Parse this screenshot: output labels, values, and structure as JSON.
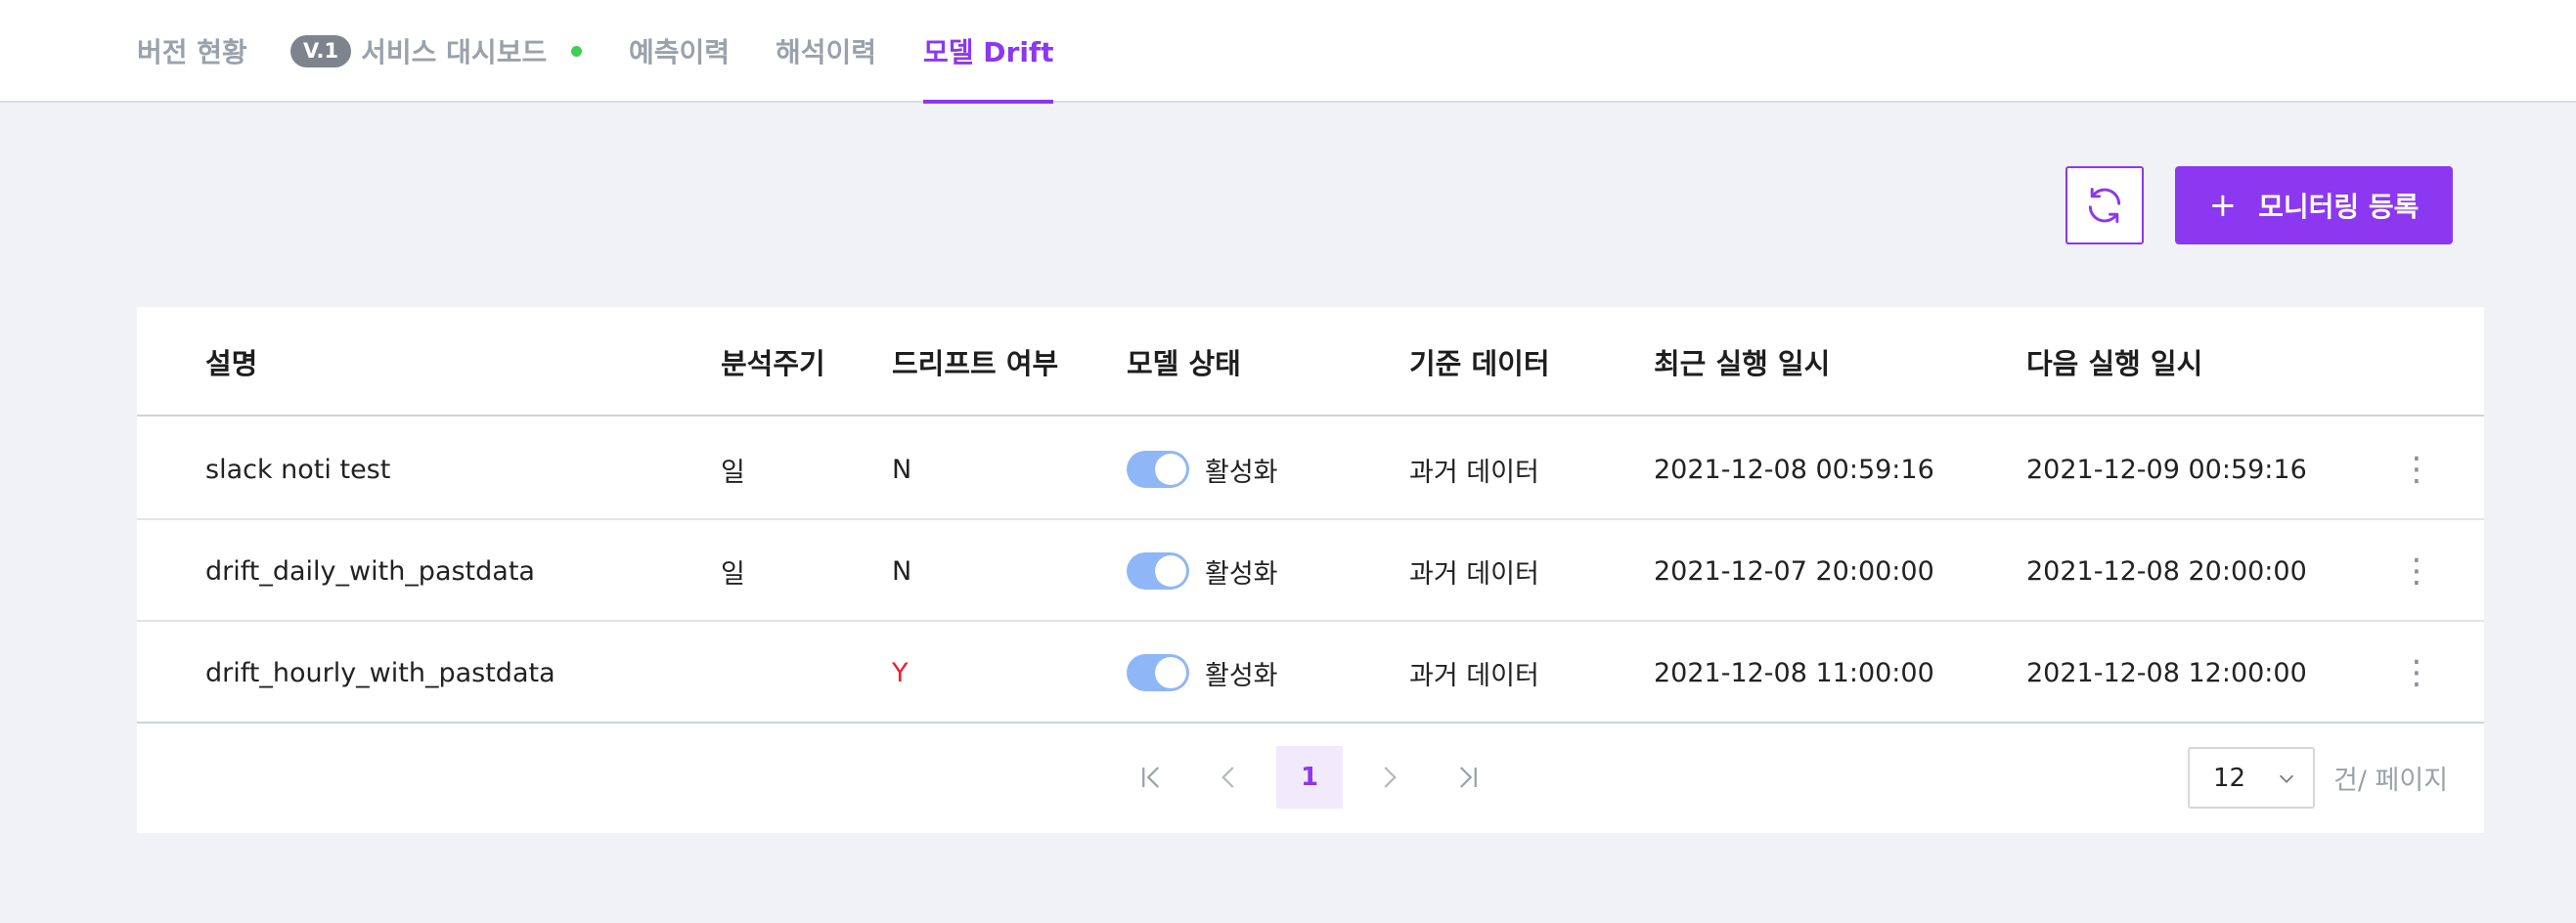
{
  "tabs": [
    {
      "label": "버전 현황",
      "active": false
    },
    {
      "badge": "V.1",
      "label": "서비스 대시보드",
      "active": false,
      "status_color": "#3ecf53"
    },
    {
      "label": "예측이력",
      "active": false
    },
    {
      "label": "해석이력",
      "active": false
    },
    {
      "label": "모델 Drift",
      "active": true
    }
  ],
  "toolbar": {
    "refresh_icon": "refresh-icon",
    "register_label": "모니터링 등록",
    "register_icon": "plus-icon"
  },
  "table": {
    "columns": [
      "설명",
      "분석주기",
      "드리프트 여부",
      "모델 상태",
      "기준 데이터",
      "최근 실행 일시",
      "다음 실행 일시"
    ],
    "rows": [
      {
        "description": "slack noti test",
        "cycle": "일",
        "drift": "N",
        "status": "활성화",
        "status_on": true,
        "base_data": "과거 데이터",
        "last_run": "2021-12-08 00:59:16",
        "next_run": "2021-12-09 00:59:16"
      },
      {
        "description": "drift_daily_with_pastdata",
        "cycle": "일",
        "drift": "N",
        "status": "활성화",
        "status_on": true,
        "base_data": "과거 데이터",
        "last_run": "2021-12-07 20:00:00",
        "next_run": "2021-12-08 20:00:00"
      },
      {
        "description": "drift_hourly_with_pastdata",
        "cycle": "",
        "drift": "Y",
        "status": "활성화",
        "status_on": true,
        "base_data": "과거 데이터",
        "last_run": "2021-12-08 11:00:00",
        "next_run": "2021-12-08 12:00:00"
      }
    ]
  },
  "pagination": {
    "current_page": "1",
    "per_page": "12",
    "per_page_suffix": "건/ 페이지"
  },
  "colors": {
    "accent": "#8c37f0",
    "drift_alert": "#e8202a",
    "toggle_on": "#8fb6f7"
  }
}
